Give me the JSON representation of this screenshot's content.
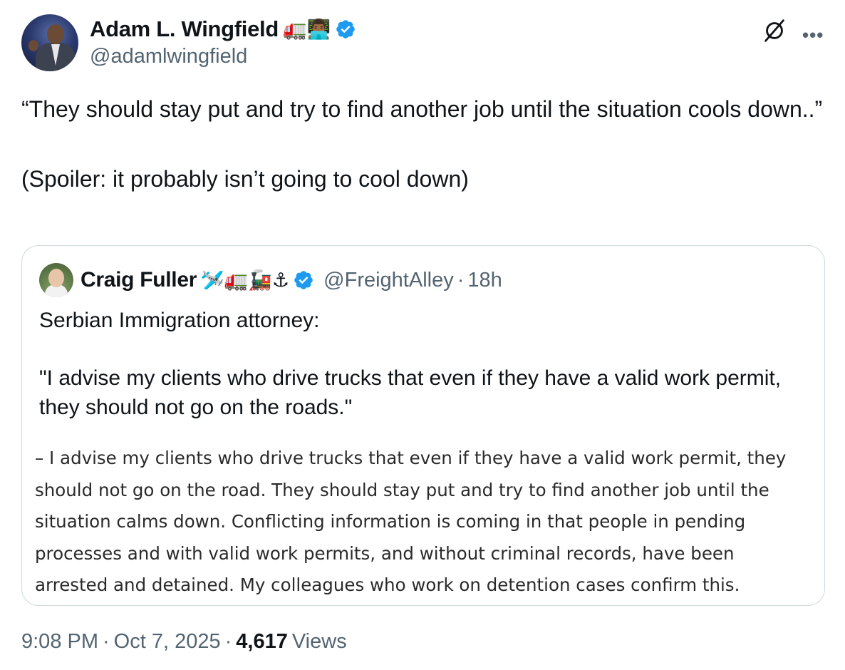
{
  "author": {
    "display_name": "Adam L. Wingfield",
    "name_emojis": "🚛👨🏾‍💻",
    "handle": "@adamlwingfield"
  },
  "tweet": {
    "line1": "“They should stay put and try to find another job until the situation cools down..”",
    "line2": "(Spoiler: it probably isn’t going to cool down)"
  },
  "quoted": {
    "display_name": "Craig Fuller",
    "name_emojis": "🛩️🚛🚂⚓",
    "handle": "@FreightAlley",
    "separator": "·",
    "time": "18h",
    "text_line1": "Serbian Immigration attorney:",
    "text_line2": "\"I advise my clients who drive trucks that even if they have a valid work permit, they should not go on the roads.\"",
    "media_text": "– I advise my clients who drive trucks that even if they have a valid work permit, they should not go on the road. They should stay put and try to find another job until the situation calms down. Conflicting information is coming in that people in pending processes and with valid work permits, and without criminal records, have been arrested and detained. My colleagues who work on detention cases confirm this."
  },
  "meta": {
    "time": "9:08 PM",
    "sep1": "·",
    "date": "Oct 7, 2025",
    "sep2": "·",
    "views_count": "4,617",
    "views_label": "Views"
  },
  "icons": {
    "verified": "verified-badge-icon",
    "grok": "grok-icon",
    "more": "more-options-icon"
  },
  "colors": {
    "text": "#0f1419",
    "secondary": "#536471",
    "verified": "#1d9bf0",
    "border": "#cfd9de"
  }
}
